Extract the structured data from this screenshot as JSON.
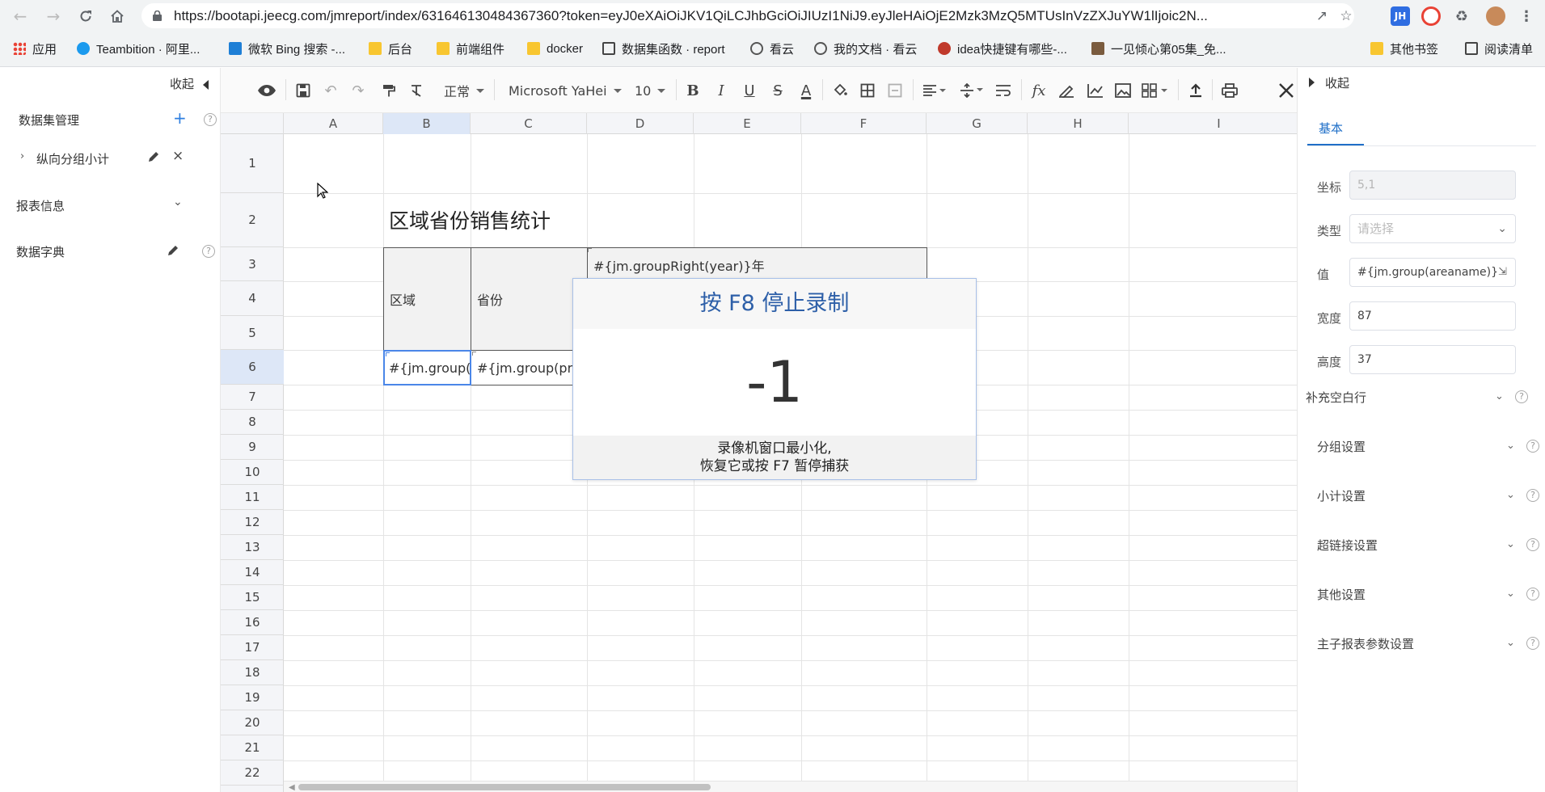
{
  "browser": {
    "url": "https://bootapi.jeecg.com/jmreport/index/631646130484367360?token=eyJ0eXAiOiJKV1QiLCJhbGciOiJIUzI1NiJ9.eyJleHAiOjE2Mzk3MzQ5MTUsInVzZXJuYW1lIjoic2N...",
    "bookmarks": [
      {
        "label": "应用",
        "icon": "apps-grid-icon"
      },
      {
        "label": "Teambition · 阿里...",
        "icon": "teambition-icon"
      },
      {
        "label": "微软 Bing 搜索 -...",
        "icon": "bing-icon"
      },
      {
        "label": "后台",
        "icon": "folder-icon"
      },
      {
        "label": "前端组件",
        "icon": "folder-icon"
      },
      {
        "label": "docker",
        "icon": "folder-icon"
      },
      {
        "label": "数据集函数 · report",
        "icon": "book-icon"
      },
      {
        "label": "看云",
        "icon": "cloud-icon"
      },
      {
        "label": "我的文档 · 看云",
        "icon": "cloud-icon"
      },
      {
        "label": "idea快捷键有哪些-...",
        "icon": "php-icon"
      },
      {
        "label": "一见倾心第05集_免...",
        "icon": "video-icon"
      },
      {
        "label": "其他书签",
        "icon": "folder-icon"
      },
      {
        "label": "阅读清单",
        "icon": "reading-list-icon"
      }
    ]
  },
  "left_panel": {
    "collapse_label": "收起",
    "dataset_manage": "数据集管理",
    "dataset_item": "纵向分组小计",
    "report_info": "报表信息",
    "data_dict": "数据字典"
  },
  "toolbar": {
    "style_select": "正常",
    "font_select": "Microsoft YaHei",
    "size_select": "10"
  },
  "sheet": {
    "columns": [
      "A",
      "B",
      "C",
      "D",
      "E",
      "F",
      "G",
      "H",
      "I"
    ],
    "rows": [
      "1",
      "2",
      "3",
      "4",
      "5",
      "6",
      "7",
      "8",
      "9",
      "10",
      "11",
      "12",
      "13",
      "14",
      "15",
      "16",
      "17",
      "18",
      "19",
      "20",
      "21",
      "22"
    ],
    "selected_column": "B",
    "selected_row": "6",
    "title": "区域省份销售统计",
    "header_year": "#{jm.groupRight(year)}年",
    "header_region": "区域",
    "header_province": "省份",
    "cell_b6": "#{jm.group(",
    "cell_c6": "#{jm.group(pro"
  },
  "recording_overlay": {
    "title": "按 F8 停止录制",
    "countdown": "-1",
    "footer_line1": "录像机窗口最小化,",
    "footer_line2": "恢复它或按 F7 暂停捕获"
  },
  "right_panel": {
    "collapse_label": "收起",
    "tab_basic": "基本",
    "coord_label": "坐标",
    "coord_value": "5,1",
    "type_label": "类型",
    "type_placeholder": "请选择",
    "value_label": "值",
    "value_value": "#{jm.group(areaname)}",
    "width_label": "宽度",
    "width_value": "87",
    "height_label": "高度",
    "height_value": "37",
    "sections": [
      "补充空白行",
      "分组设置",
      "小计设置",
      "超链接设置",
      "其他设置",
      "主子报表参数设置"
    ]
  },
  "colors": {
    "accent": "#4a86e8",
    "tab_active": "#1f6fc8",
    "rec_title": "#2d5fa8"
  }
}
